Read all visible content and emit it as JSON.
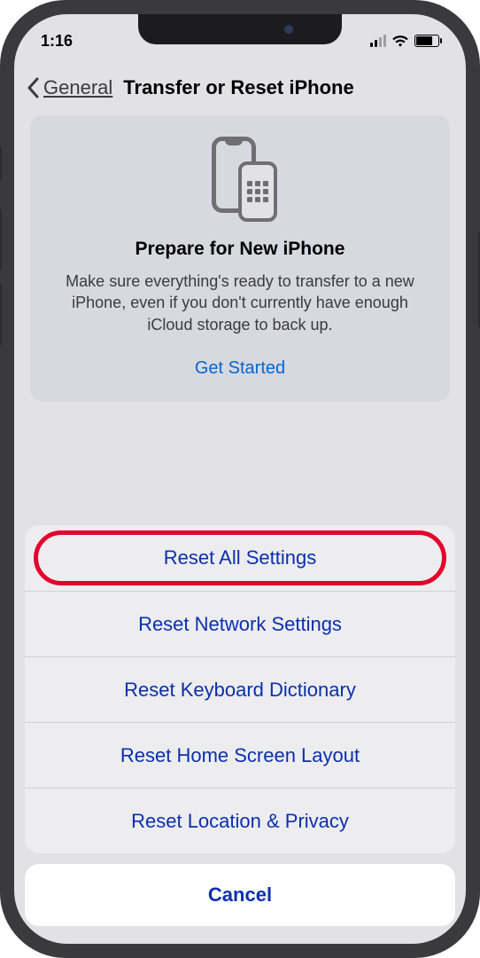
{
  "status_bar": {
    "time": "1:16"
  },
  "nav": {
    "back_label": "General",
    "title": "Transfer or Reset iPhone"
  },
  "info_card": {
    "title": "Prepare for New iPhone",
    "description": "Make sure everything's ready to transfer to a new iPhone, even if you don't currently have enough iCloud storage to back up.",
    "cta": "Get Started"
  },
  "sheet": {
    "items": [
      "Reset All Settings",
      "Reset Network Settings",
      "Reset Keyboard Dictionary",
      "Reset Home Screen Layout",
      "Reset Location & Privacy"
    ],
    "cancel": "Cancel"
  }
}
